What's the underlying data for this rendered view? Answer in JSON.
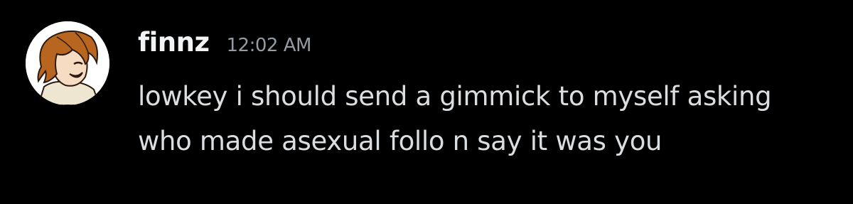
{
  "message": {
    "username": "finnz",
    "timestamp": "12:02 AM",
    "text": "lowkey i should send a gimmick to myself asking who made asexual follo n say it was you",
    "avatar_icon": "user-avatar-cartoon-icon"
  },
  "colors": {
    "background": "#000000",
    "username": "#f2f3f5",
    "timestamp": "#949ba4",
    "text": "#dbdee1",
    "avatar_background": "#ffffff",
    "avatar_hair": "#b8651f"
  }
}
